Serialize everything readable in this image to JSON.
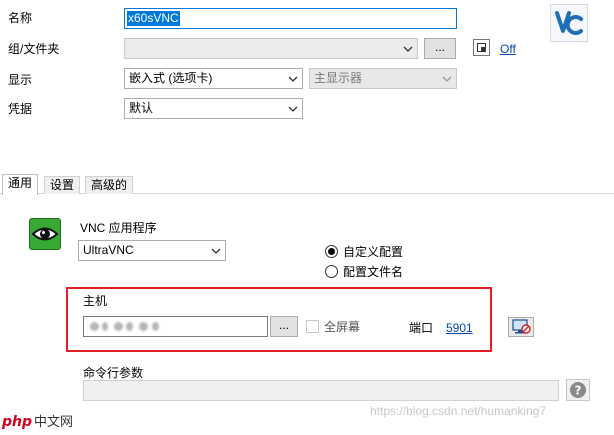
{
  "form": {
    "name_label": "名称",
    "name_value": "x60sVNC",
    "group_label": "组/文件夹",
    "group_value": "",
    "group_browse_label": "...",
    "group_toggle_label": "Off",
    "display_label": "显示",
    "display_value": "嵌入式 (选项卡)",
    "monitor_value": "主显示器",
    "credentials_label": "凭据",
    "credentials_value": "默认"
  },
  "tabs": [
    {
      "label": "通用",
      "active": true
    },
    {
      "label": "设置",
      "active": false
    },
    {
      "label": "高级的",
      "active": false
    }
  ],
  "general": {
    "app_label": "VNC 应用程序",
    "app_value": "UltraVNC",
    "radio_custom": "自定义配置",
    "radio_config_file": "配置文件名",
    "host_label": "主机",
    "host_browse_label": "...",
    "fullscreen_label": "全屏幕",
    "port_label": "端口",
    "port_value": "5901",
    "cmdline_label": "命令行参数",
    "cmdline_value": ""
  },
  "overlay": {
    "watermark": "https://blog.csdn.net/humanking7",
    "php_logo_text": "php",
    "php_logo_cn": "中文网"
  },
  "colors": {
    "accent": "#0078d7",
    "link": "#0645ad",
    "highlight_box": "#e01e25",
    "vnc_blue": "#1e6fb8",
    "eye_green": "#39a935"
  },
  "icons": {
    "vnc_logo": "vnc-logo-icon",
    "app_eye": "eye-icon",
    "group_toggle": "toggle-square-icon",
    "connect": "monitor-network-icon",
    "help": "question-icon"
  }
}
